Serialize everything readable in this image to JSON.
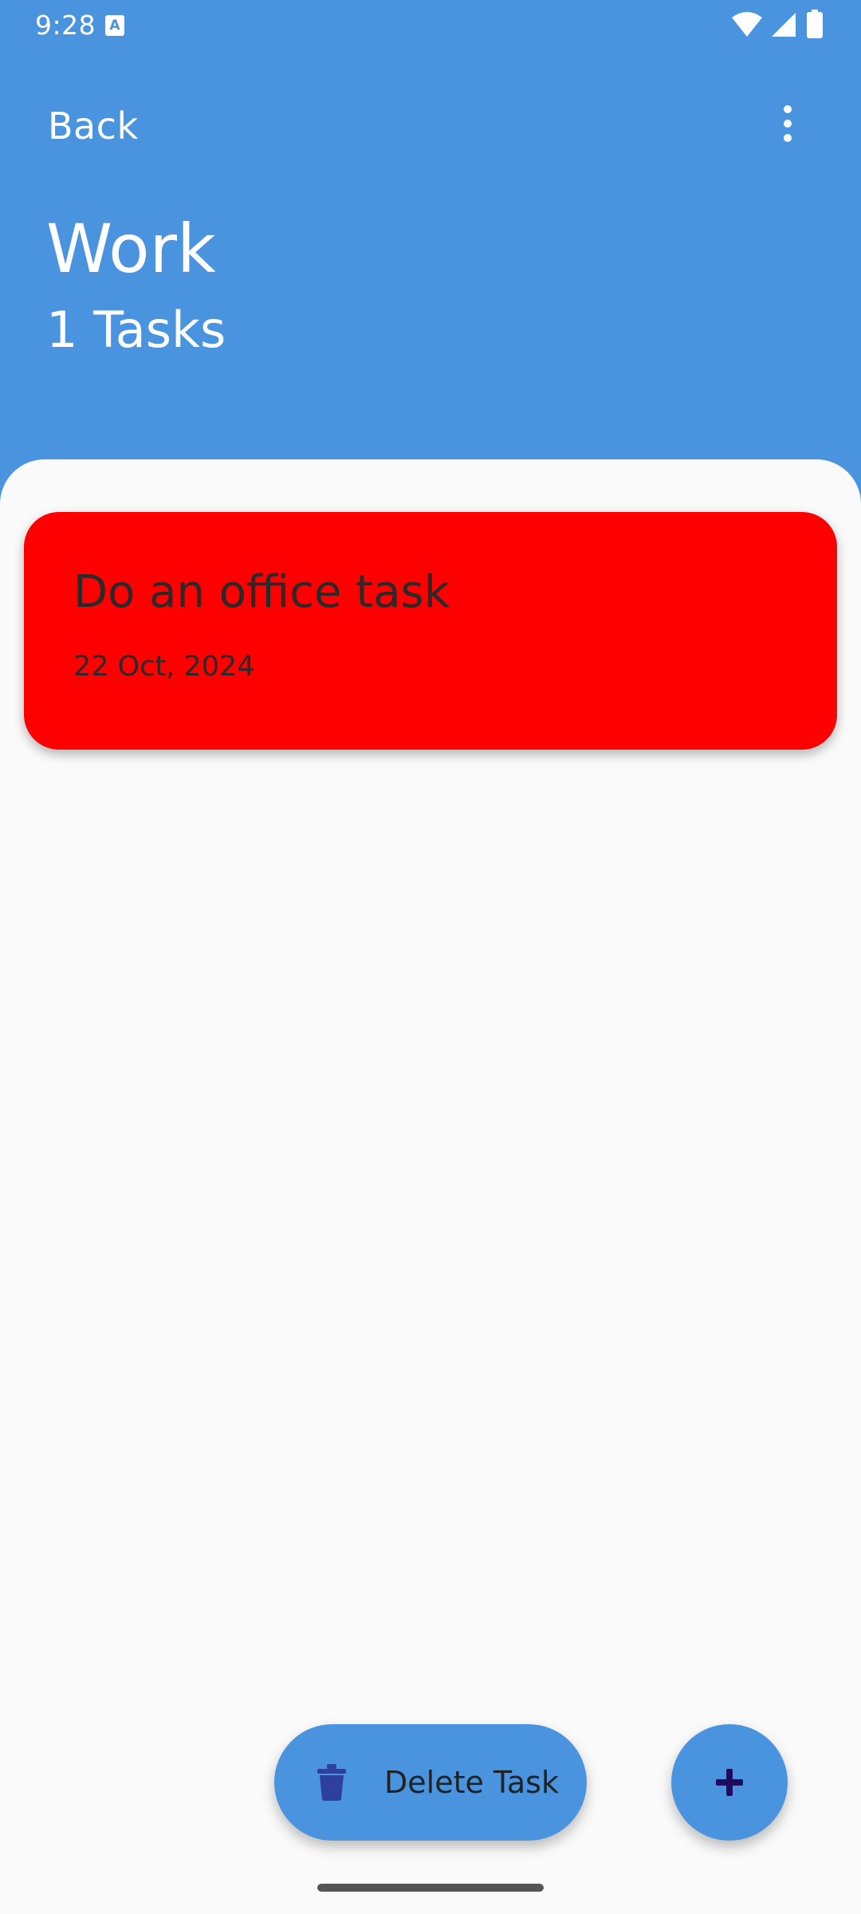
{
  "status_bar": {
    "time": "9:28",
    "app_icon_letter": "A"
  },
  "header": {
    "back_label": "Back",
    "title": "Work",
    "task_count": "1 Tasks"
  },
  "tasks": [
    {
      "title": "Do an office task",
      "date": "22 Oct, 2024",
      "color": "#ff0000"
    }
  ],
  "actions": {
    "delete_label": "Delete Task",
    "add_icon": "plus-icon",
    "delete_icon": "trash-icon"
  },
  "colors": {
    "primary": "#4a93df",
    "surface": "#fafafa",
    "task_red": "#ff0000",
    "icon_dark_blue": "#2f3f9e",
    "plus_dark": "#1f0a5e"
  }
}
